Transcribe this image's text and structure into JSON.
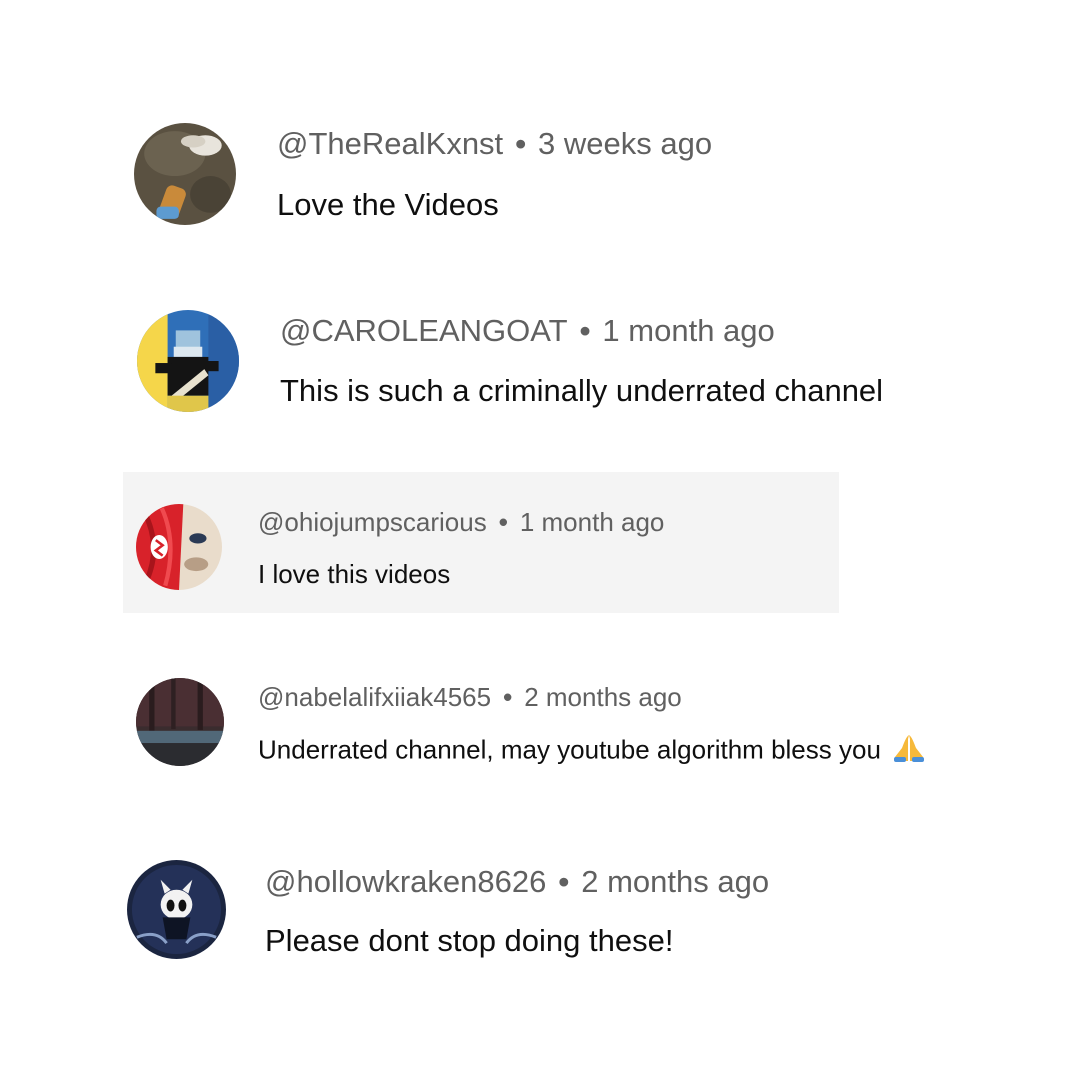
{
  "comments": [
    {
      "handle": "@TheRealKxnst",
      "separator": "•",
      "time": "3 weeks ago",
      "text": "Love the Videos"
    },
    {
      "handle": "@CAROLEANGOAT",
      "separator": "•",
      "time": "1 month ago",
      "text": "This is such a criminally underrated channel"
    },
    {
      "handle": "@ohiojumpscarious",
      "separator": "•",
      "time": "1 month ago",
      "text": "I love this videos"
    },
    {
      "handle": "@nabelalifxiiak4565",
      "separator": "•",
      "time": "2 months ago",
      "text": "Underrated channel, may youtube algorithm bless you",
      "emoji_icon": "folded-hands-icon"
    },
    {
      "handle": "@hollowkraken8626",
      "separator": "•",
      "time": "2 months ago",
      "text": "Please dont stop doing these!"
    }
  ],
  "colors": {
    "meta_text": "#606060",
    "body_text": "#0f0f0f",
    "highlight_background": "#f4f4f4"
  }
}
